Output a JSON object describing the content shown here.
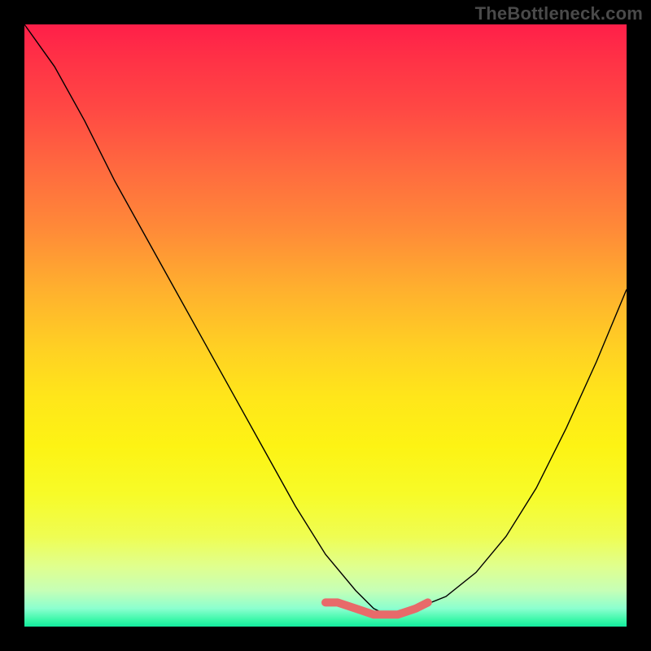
{
  "watermark": "TheBottleneck.com",
  "chart_data": {
    "type": "line",
    "title": "",
    "xlabel": "",
    "ylabel": "",
    "xlim": [
      0,
      100
    ],
    "ylim": [
      0,
      100
    ],
    "grid": false,
    "legend": false,
    "annotations": [],
    "series": [
      {
        "name": "curve",
        "color": "#000000",
        "x": [
          0,
          5,
          10,
          15,
          20,
          25,
          30,
          35,
          40,
          45,
          50,
          55,
          58,
          60,
          62,
          65,
          70,
          75,
          80,
          85,
          90,
          95,
          100
        ],
        "y": [
          100,
          93,
          84,
          74,
          65,
          56,
          47,
          38,
          29,
          20,
          12,
          6,
          3,
          2,
          2,
          3,
          5,
          9,
          15,
          23,
          33,
          44,
          56
        ]
      }
    ],
    "markers": {
      "name": "highlight-band",
      "color": "#e86a6a",
      "x": [
        50,
        52,
        55,
        58,
        60,
        62,
        65,
        67
      ],
      "y": [
        4,
        4,
        3,
        2,
        2,
        2,
        3,
        4
      ]
    },
    "background_gradient": {
      "type": "vertical",
      "stops": [
        {
          "pos": 0.0,
          "color": "#ff1f49"
        },
        {
          "pos": 0.5,
          "color": "#ffd123"
        },
        {
          "pos": 0.8,
          "color": "#f7fb28"
        },
        {
          "pos": 0.95,
          "color": "#c6ffb6"
        },
        {
          "pos": 1.0,
          "color": "#14eaa0"
        }
      ]
    }
  }
}
